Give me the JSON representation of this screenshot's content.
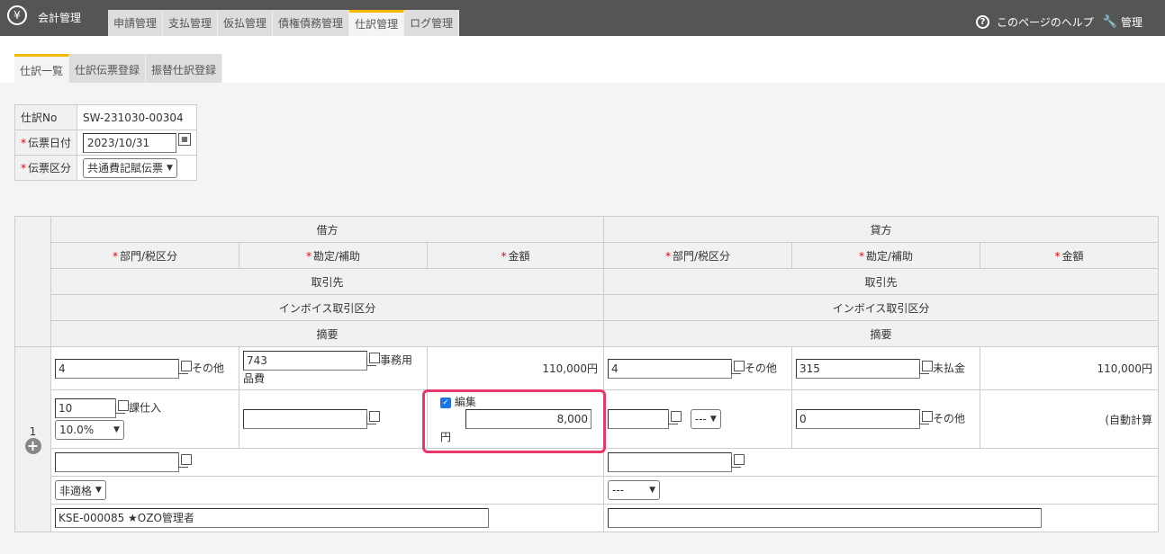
{
  "header": {
    "app_title": "会計管理",
    "app_icon": "yen-ledger-icon",
    "tabs": [
      "申請管理",
      "支払管理",
      "仮払管理",
      "債権債務管理",
      "仕訳管理",
      "ログ管理"
    ],
    "active_tab": "仕訳管理",
    "help_label": "このページのヘルプ",
    "admin_label": "管理"
  },
  "subtabs": [
    "仕訳一覧",
    "仕訳伝票登録",
    "振替仕訳登録"
  ],
  "info": {
    "journal_no_label": "仕訳No",
    "journal_no": "SW-231030-00304",
    "date_label": "伝票日付",
    "date_value": "2023/10/31",
    "type_label": "伝票区分",
    "type_value": "共通費記賦伝票"
  },
  "table_headers": {
    "debit": "借方",
    "credit": "貸方",
    "dept_tax": "部門/税区分",
    "account": "勘定/補助",
    "amount": "金額",
    "partner": "取引先",
    "invoice": "インボイス取引区分",
    "summary": "摘要"
  },
  "row": {
    "number": "1",
    "debit": {
      "dept": "4",
      "dept_name": "その他",
      "account": "743",
      "account_name_1": "事務用",
      "account_name_2": "品費",
      "amount": "110,000円",
      "tax_code": "10",
      "tax_name": "課仕入",
      "tax_rate": "10.0%",
      "edit_label": "編集",
      "tax_amount": "8,000",
      "yen": "円",
      "invoice": "非適格",
      "summary": "KSE-000085 ★OZO管理者"
    },
    "credit": {
      "dept": "4",
      "dept_name": "その他",
      "account": "315",
      "account_name": "未払金",
      "amount": "110,000円",
      "tax_select": "---",
      "tax_code": "0",
      "tax_name": "その他",
      "auto_calc": "(自動計算",
      "invoice": "---"
    }
  }
}
